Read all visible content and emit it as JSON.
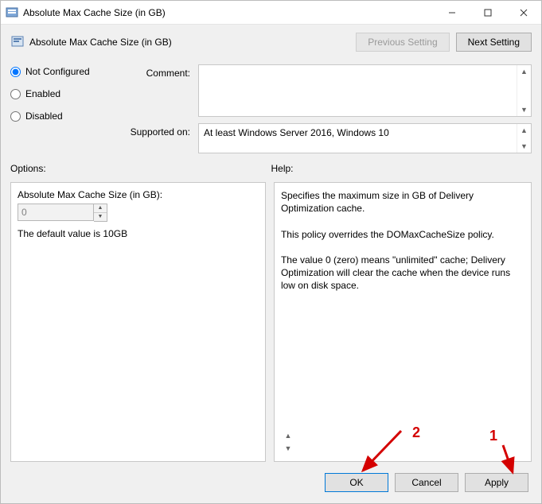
{
  "window": {
    "title": "Absolute Max Cache Size (in GB)"
  },
  "header": {
    "page_title": "Absolute Max Cache Size (in GB)",
    "previous_btn": "Previous Setting",
    "next_btn": "Next Setting"
  },
  "config": {
    "not_configured": "Not Configured",
    "enabled": "Enabled",
    "disabled": "Disabled"
  },
  "meta": {
    "comment_label": "Comment:",
    "comment_value": "",
    "supported_label": "Supported on:",
    "supported_value": "At least Windows Server 2016, Windows 10"
  },
  "labels": {
    "options": "Options:",
    "help": "Help:"
  },
  "options": {
    "field_label": "Absolute Max Cache Size (in GB):",
    "field_value": "0",
    "note": "The default value is 10GB"
  },
  "help": {
    "p1": "Specifies the maximum size in GB of Delivery Optimization cache.",
    "p2": "This policy overrides the DOMaxCacheSize policy.",
    "p3": "The value 0 (zero) means \"unlimited\" cache; Delivery Optimization will clear the cache when the device runs low on disk space."
  },
  "footer": {
    "ok": "OK",
    "cancel": "Cancel",
    "apply": "Apply"
  },
  "annotations": {
    "one": "1",
    "two": "2"
  }
}
